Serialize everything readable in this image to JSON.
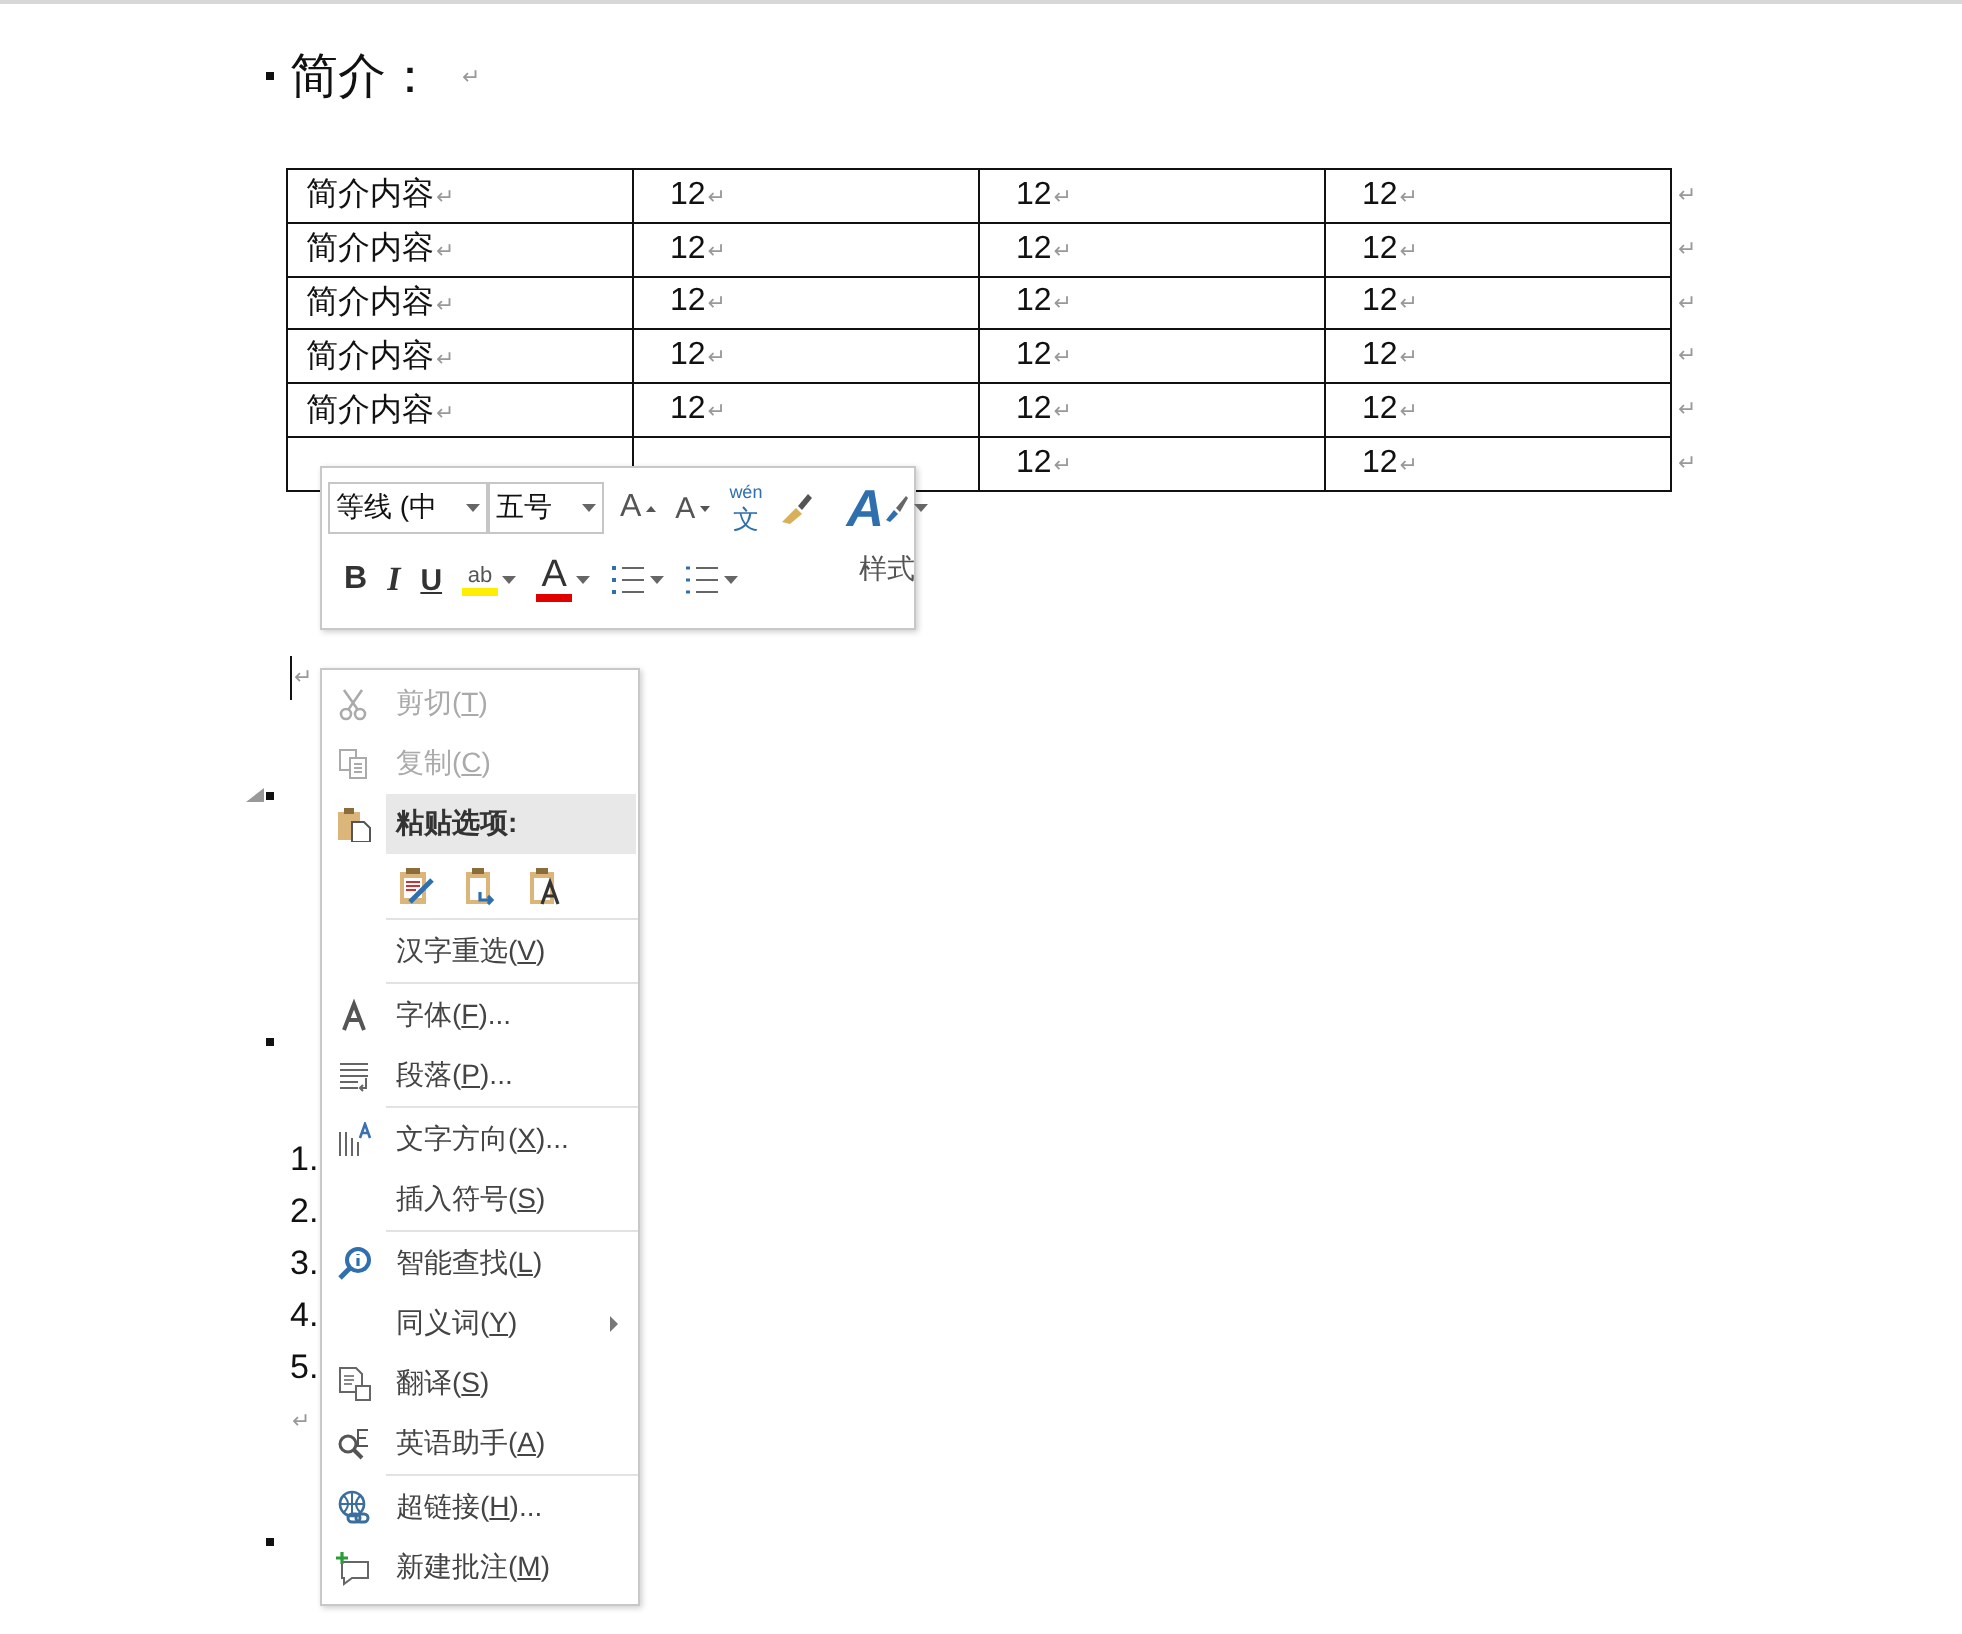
{
  "document": {
    "blocks": [
      {
        "kind": "heading",
        "text": "简介：",
        "mark": "↵",
        "collapse_arrow": false
      },
      {
        "kind": "table",
        "rows": [
          [
            {
              "text": "简介内容",
              "mark": "↵"
            },
            {
              "text": "12",
              "mark": "↵"
            },
            {
              "text": "12",
              "mark": "↵"
            },
            {
              "text": "12",
              "mark": "↵"
            }
          ],
          [
            {
              "text": "简介内容",
              "mark": "↵"
            },
            {
              "text": "12",
              "mark": "↵"
            },
            {
              "text": "12",
              "mark": "↵"
            },
            {
              "text": "12",
              "mark": "↵"
            }
          ],
          [
            {
              "text": "简介内容",
              "mark": "↵"
            },
            {
              "text": "12",
              "mark": "↵"
            },
            {
              "text": "12",
              "mark": "↵"
            },
            {
              "text": "12",
              "mark": "↵"
            }
          ],
          [
            {
              "text": "简介内容",
              "mark": "↵"
            },
            {
              "text": "12",
              "mark": "↵"
            },
            {
              "text": "12",
              "mark": "↵"
            },
            {
              "text": "12",
              "mark": "↵"
            }
          ],
          [
            {
              "text": "简介内容",
              "mark": "↵"
            },
            {
              "text": "12",
              "mark": "↵"
            },
            {
              "text": "12",
              "mark": "↵"
            },
            {
              "text": "12",
              "mark": "↵"
            }
          ],
          [
            {},
            {},
            {
              "text": "12",
              "mark": "↵"
            },
            {
              "text": "12",
              "mark": "↵"
            }
          ]
        ],
        "row_marks": [
          "↵",
          "↵",
          "↵",
          "↵",
          "↵",
          "↵"
        ]
      },
      {
        "kind": "paragraph",
        "mark": "↵",
        "cursor": true
      },
      {
        "kind": "heading",
        "collapse_arrow": true
      },
      {
        "kind": "heading",
        "collapse_arrow": false
      },
      {
        "kind": "list",
        "items": [
          "1.",
          "2.",
          "3.",
          "4.",
          "5."
        ]
      },
      {
        "kind": "paragraph",
        "mark": "↵",
        "cursor": false
      },
      {
        "kind": "heading",
        "collapse_arrow": false
      }
    ]
  },
  "mini_toolbar": {
    "font_name": "等线 (中",
    "font_size": "五号",
    "grow_letter": "A",
    "shrink_letter": "A",
    "phonetic_top": "wén",
    "phonetic_bottom": "文",
    "styles_letter": "A",
    "bold": "B",
    "italic": "I",
    "underline": "U",
    "highlight_text": "ab",
    "font_color_letter": "A",
    "styles_label": "样式"
  },
  "context_menu": {
    "items": [
      {
        "kind": "item",
        "before": "剪切(",
        "key": "T",
        "after": ")",
        "disabled": true,
        "submenu": false
      },
      {
        "kind": "item",
        "before": "复制(",
        "key": "C",
        "after": ")",
        "disabled": true,
        "submenu": false
      },
      {
        "kind": "header",
        "text": "粘贴选项:"
      },
      {
        "kind": "paste_options"
      },
      {
        "kind": "separator"
      },
      {
        "kind": "item",
        "before": "汉字重选(",
        "key": "V",
        "after": ")",
        "disabled": false,
        "submenu": false
      },
      {
        "kind": "separator"
      },
      {
        "kind": "item",
        "before": "字体(",
        "key": "F",
        "after": ")...",
        "disabled": false,
        "submenu": false
      },
      {
        "kind": "item",
        "before": "段落(",
        "key": "P",
        "after": ")...",
        "disabled": false,
        "submenu": false
      },
      {
        "kind": "separator"
      },
      {
        "kind": "item",
        "before": "文字方向(",
        "key": "X",
        "after": ")...",
        "disabled": false,
        "submenu": false
      },
      {
        "kind": "item",
        "before": "插入符号(",
        "key": "S",
        "after": ")",
        "disabled": false,
        "submenu": false
      },
      {
        "kind": "separator"
      },
      {
        "kind": "item",
        "before": "智能查找(",
        "key": "L",
        "after": ")",
        "disabled": false,
        "submenu": false
      },
      {
        "kind": "item",
        "before": "同义词(",
        "key": "Y",
        "after": ")",
        "disabled": false,
        "submenu": true
      },
      {
        "kind": "item",
        "before": "翻译(",
        "key": "S",
        "after": ")",
        "disabled": false,
        "submenu": false
      },
      {
        "kind": "item",
        "before": "英语助手(",
        "key": "A",
        "after": ")",
        "disabled": false,
        "submenu": false
      },
      {
        "kind": "separator"
      },
      {
        "kind": "item",
        "before": "超链接(",
        "key": "H",
        "after": ")...",
        "disabled": false,
        "submenu": false
      },
      {
        "kind": "item",
        "before": "新建批注(",
        "key": "M",
        "after": ")",
        "disabled": false,
        "submenu": false
      }
    ]
  }
}
